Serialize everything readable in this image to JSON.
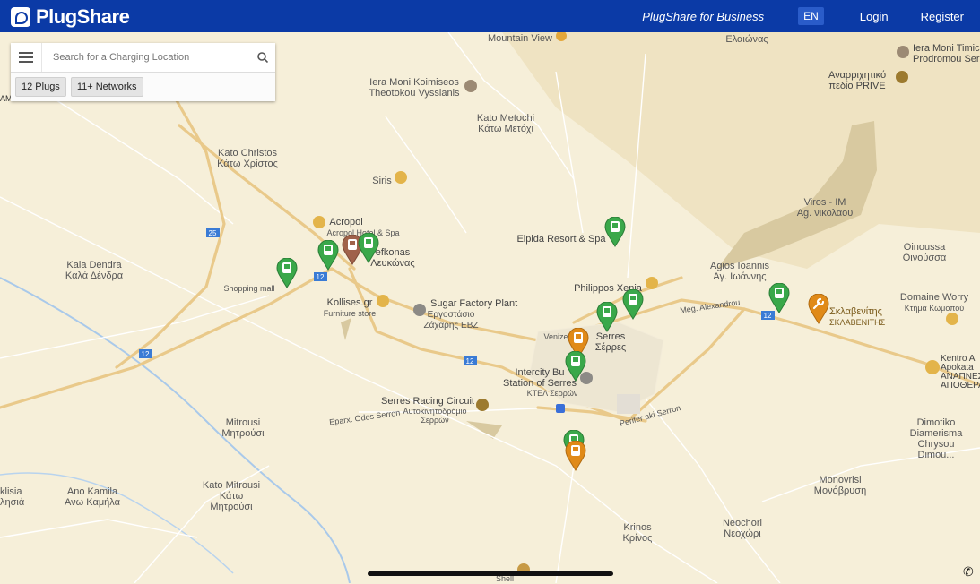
{
  "header": {
    "logo_text": "PlugShare",
    "business_link": "PlugShare for Business",
    "language": "EN",
    "login": "Login",
    "register": "Register"
  },
  "search": {
    "placeholder": "Search for a Charging Location",
    "plugs_chip": "12 Plugs",
    "networks_chip": "11+ Networks"
  },
  "map": {
    "labels": [
      {
        "id": "mountain-view",
        "text": "Mountain View"
      },
      {
        "id": "elaionas",
        "text": "Ελαιώνας"
      },
      {
        "id": "iera-moni-timiou",
        "text": "Iera Moni Timic\nProdromou Ser"
      },
      {
        "id": "anarrichitiko",
        "text": "Αναρριχητικό\nπεδίο PRIVE"
      },
      {
        "id": "iera-moni-vyssianis",
        "text": "Iera Moni Koimiseos\nTheotokou Vyssianis"
      },
      {
        "id": "kato-metochi",
        "text": "Kato Metochi\nΚάτω Μετόχι"
      },
      {
        "id": "kato-christos",
        "text": "Kato Christos\nΚάτω Χρίστος"
      },
      {
        "id": "siris",
        "text": "Siris"
      },
      {
        "id": "viros",
        "text": "Viros - IM\nAg. νικολαου"
      },
      {
        "id": "acropol",
        "text": "Acropol"
      },
      {
        "id": "acropol-sub",
        "text": "Acropol Hotel & Spa"
      },
      {
        "id": "lefkonas",
        "text": "efkonas\nΛευκώνας"
      },
      {
        "id": "elpida",
        "text": "Elpida Resort & Spa"
      },
      {
        "id": "oinoussa",
        "text": "Oinoussa\nΟινούσσα"
      },
      {
        "id": "kala-dendra",
        "text": "Kala Dendra\nΚαλά Δένδρα"
      },
      {
        "id": "agios-ioannis",
        "text": "Agios Ioannis\nΑγ. Ιωάννης"
      },
      {
        "id": "shopping-mall",
        "text": "Shopping mall"
      },
      {
        "id": "kollises",
        "text": "Kollises.gr"
      },
      {
        "id": "furniture",
        "text": "Furniture store"
      },
      {
        "id": "sugar-factory",
        "text": "Sugar Factory Plant"
      },
      {
        "id": "sugar-factory-gr",
        "text": "Εργοστάσιο\nΖάχαρης ΕΒΖ"
      },
      {
        "id": "philippos",
        "text": "Philippos Xenia"
      },
      {
        "id": "domaine",
        "text": "Domaine Worry"
      },
      {
        "id": "domaine-gr",
        "text": "Κτήμα Κωμοπού"
      },
      {
        "id": "sklavenitis",
        "text": "Σκλαβενίτης"
      },
      {
        "id": "sklavenitis-sub",
        "text": "ΣΚΛΑΒΕΝΙΤΗΣ"
      },
      {
        "id": "serres",
        "text": "Serres\nΣέρρες"
      },
      {
        "id": "kentro",
        "text": "Kentro A\nApokata\nΑΝΑΠΝΕΣ\nΑΠΟΘΕΡΑ"
      },
      {
        "id": "intercity",
        "text": "Intercity Bu\nStation of Serres"
      },
      {
        "id": "ktel",
        "text": "ΚΤΕΛ Σερρών"
      },
      {
        "id": "racing",
        "text": "Serres Racing Circuit"
      },
      {
        "id": "racing-gr",
        "text": "Αυτοκινητοδρόμιο\nΣερρών"
      },
      {
        "id": "mitrousi",
        "text": "Mitrousi\nΜητρούσι"
      },
      {
        "id": "dimotiko",
        "text": "Dimotiko\nDiamerisma\nChrysou\nDimou..."
      },
      {
        "id": "monovrisi",
        "text": "Monovrisi\nΜονόβρυση"
      },
      {
        "id": "kato-mitrousi",
        "text": "Kato Mitrousi\nΚάτω\nΜητρούσι"
      },
      {
        "id": "ano-kamila",
        "text": "Ano Kamila\nΑνω Καμήλα"
      },
      {
        "id": "klisia",
        "text": "klisia\nλησιά"
      },
      {
        "id": "krinos",
        "text": "Krinos\nΚρίνος"
      },
      {
        "id": "neochori",
        "text": "Neochori\nΝεοχώρι"
      },
      {
        "id": "shell",
        "text": "Shell"
      },
      {
        "id": "road-12-a",
        "text": "12"
      },
      {
        "id": "road-12-b",
        "text": "12"
      },
      {
        "id": "road-12-c",
        "text": "12"
      },
      {
        "id": "road-12-d",
        "text": "12"
      },
      {
        "id": "road-25",
        "text": "25"
      },
      {
        "id": "meg-alexandrou",
        "text": "Meg. Alexandrou"
      },
      {
        "id": "venizelou",
        "text": "Venizel"
      },
      {
        "id": "perifereiaki",
        "text": "Perifer aki Serron"
      },
      {
        "id": "eparchiaki",
        "text": "Eparx. Odos Serron"
      },
      {
        "id": "am",
        "text": "AM"
      }
    ],
    "colors": {
      "land": "#f6efd9",
      "road_major": "#e9c98a",
      "road_minor": "#ffffff",
      "mountain": "#d8c9a0",
      "water": "#a9c9ea",
      "pin_green": "#3aa84a",
      "pin_orange": "#e08a18",
      "pin_brown": "#a0624a",
      "poi_brown": "#9c7a2e"
    }
  }
}
